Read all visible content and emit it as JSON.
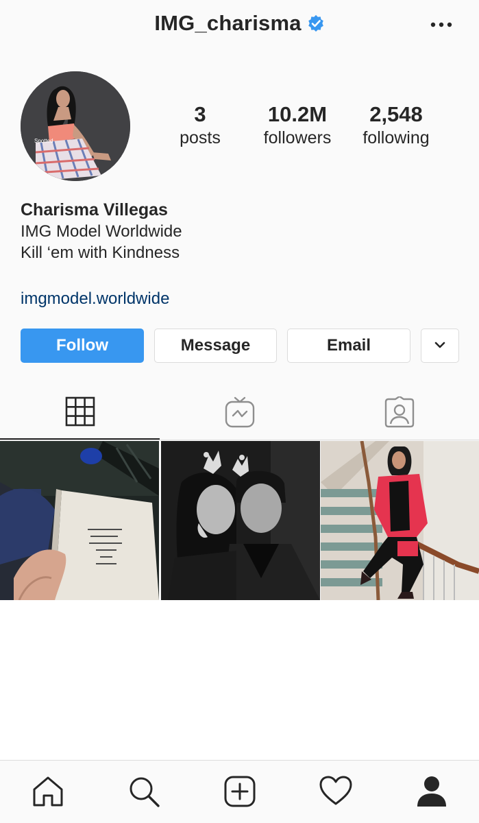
{
  "header": {
    "username": "IMG_charisma",
    "verified_icon": "verified-badge-icon",
    "more_icon": "more-options-icon"
  },
  "avatar": {
    "caption": "Spotted"
  },
  "stats": {
    "posts": {
      "count": "3",
      "label": "posts"
    },
    "followers": {
      "count": "10.2M",
      "label": "followers"
    },
    "following": {
      "count": "2,548",
      "label": "following"
    }
  },
  "bio": {
    "name": "Charisma Villegas",
    "line1": "IMG Model Worldwide",
    "line2": "Kill ‘em with Kindness",
    "link": "imgmodel.worldwide"
  },
  "actions": {
    "follow": "Follow",
    "message": "Message",
    "email": "Email",
    "more_icon": "chevron-down-icon"
  },
  "tabs": [
    {
      "name": "grid",
      "icon": "grid-icon",
      "active": true
    },
    {
      "name": "igtv",
      "icon": "igtv-icon",
      "active": false
    },
    {
      "name": "tagged",
      "icon": "tagged-icon",
      "active": false
    }
  ],
  "posts": [
    {
      "description_icon": "book-photo"
    },
    {
      "description_icon": "couple-photo"
    },
    {
      "description_icon": "staircase-photo"
    }
  ],
  "nav": {
    "home": "home-icon",
    "search": "search-icon",
    "add": "add-post-icon",
    "activity": "heart-icon",
    "profile": "profile-icon"
  },
  "colors": {
    "accent": "#3897f0",
    "link": "#003569",
    "text": "#262626",
    "border": "#dbdbdb",
    "background": "#fafafa"
  }
}
